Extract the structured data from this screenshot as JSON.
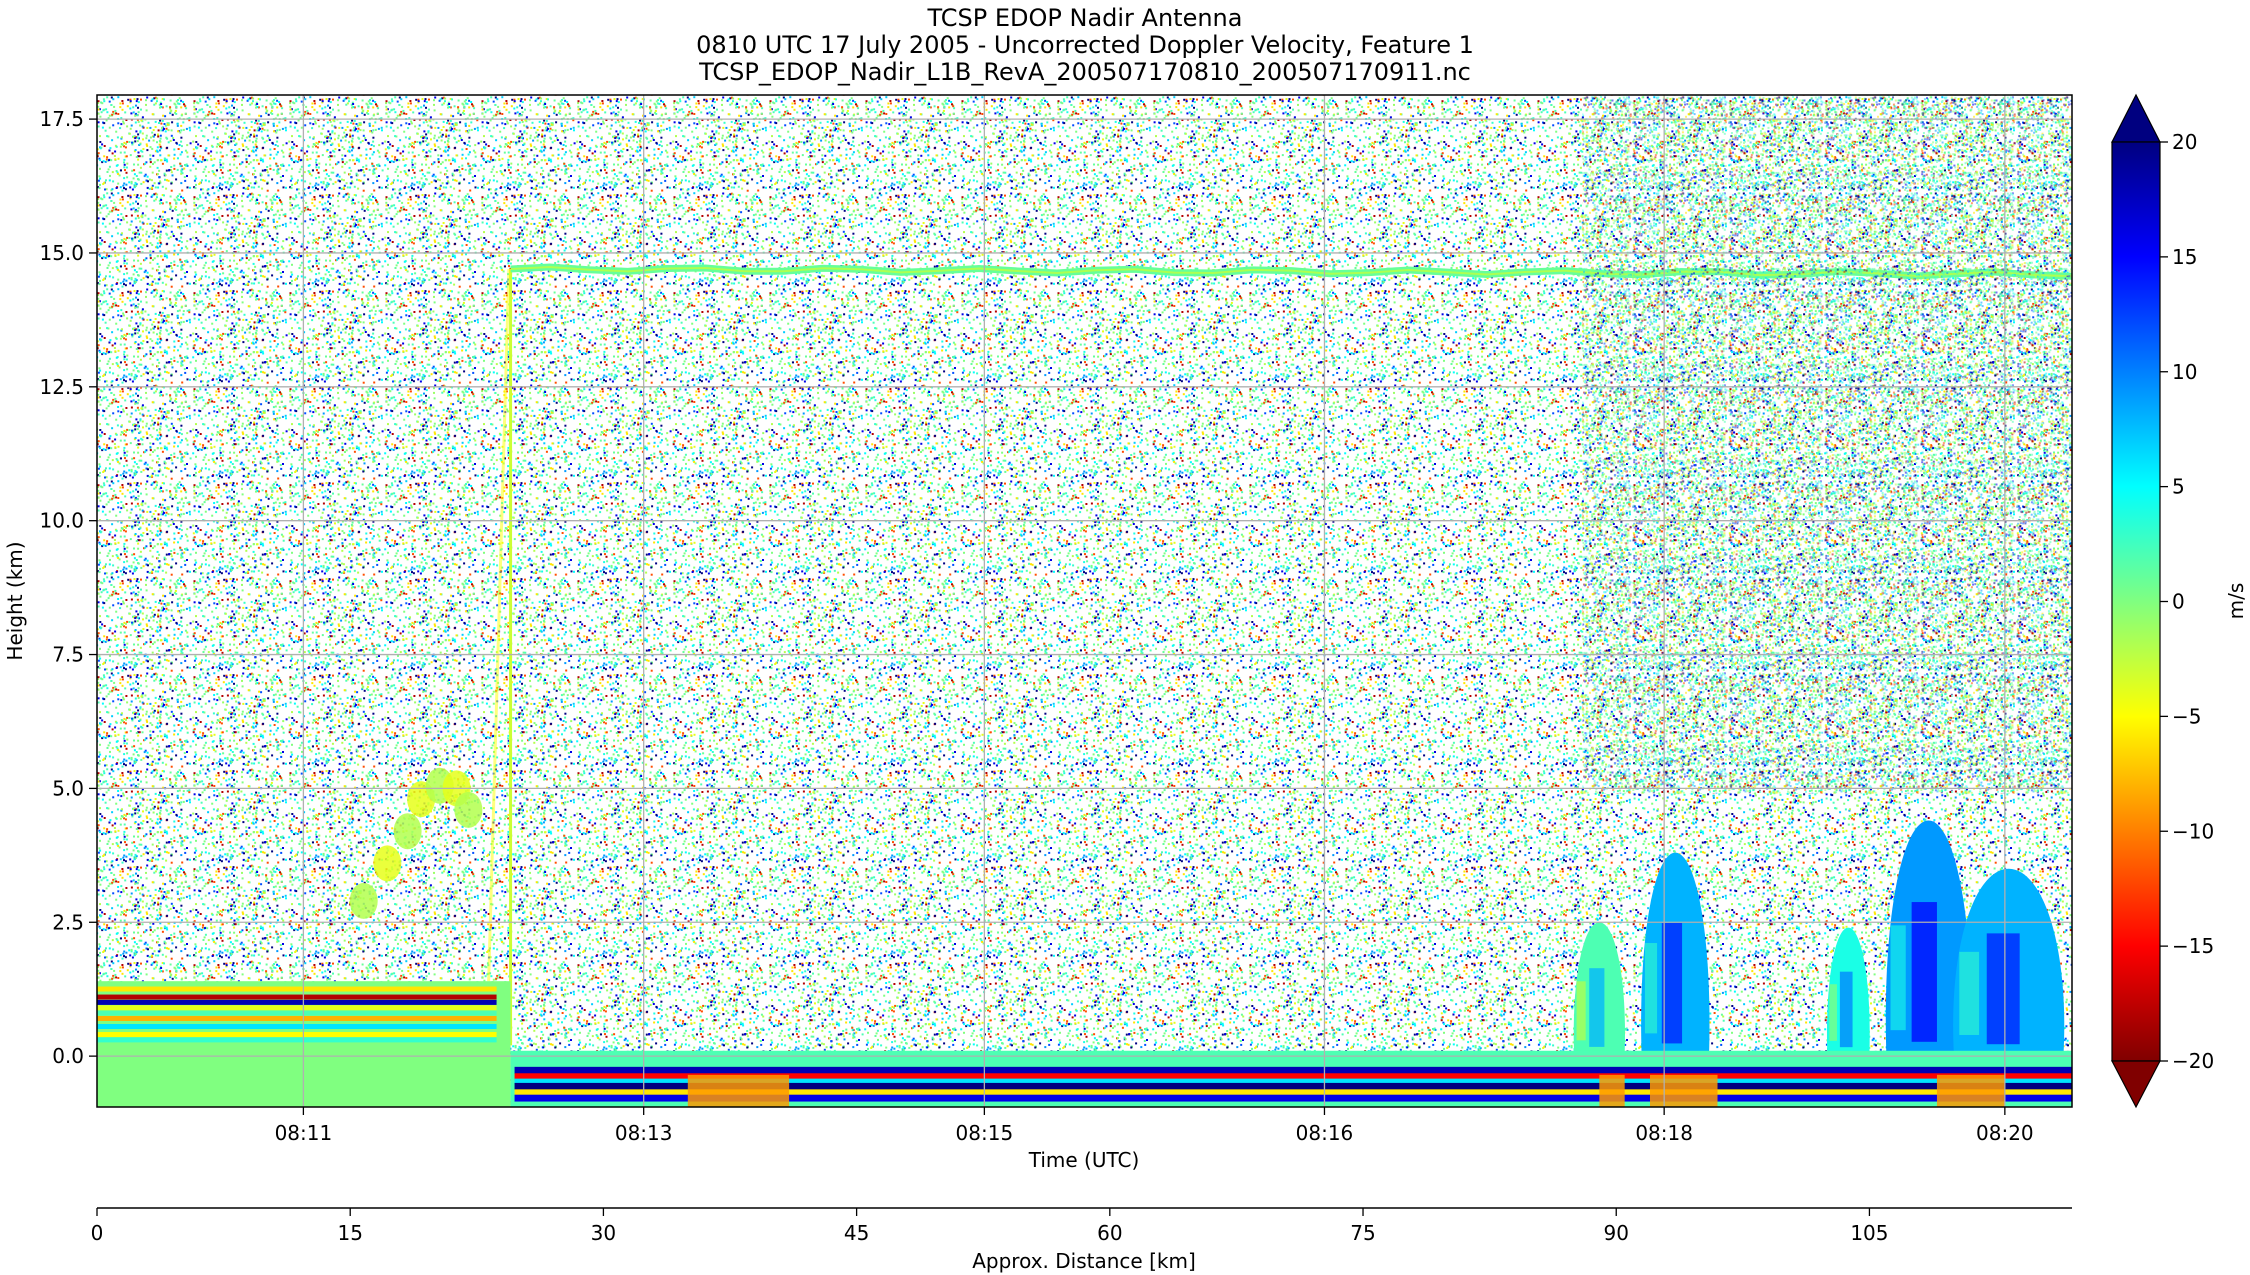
{
  "chart_data": {
    "type": "heatmap",
    "title_lines": [
      "TCSP EDOP Nadir Antenna",
      "0810 UTC 17 July 2005 - Uncorrected Doppler Velocity, Feature 1",
      "TCSP_EDOP_Nadir_L1B_RevA_200507170810_200507170911.nc"
    ],
    "xlabel": "Time (UTC)",
    "ylabel": "Height (km)",
    "x2label": "Approx. Distance [km]",
    "colorbar_label": "m/s",
    "ylim": [
      -0.95,
      17.95
    ],
    "y_ticks": [
      0.0,
      2.5,
      5.0,
      7.5,
      10.0,
      12.5,
      15.0,
      17.5
    ],
    "y_tick_labels": [
      "0.0",
      "2.5",
      "5.0",
      "7.5",
      "10.0",
      "12.5",
      "15.0",
      "17.5"
    ],
    "x_tick_labels": [
      "08:11",
      "08:13",
      "08:15",
      "08:16",
      "08:18",
      "08:20"
    ],
    "distance_ticks": [
      0,
      15,
      30,
      45,
      60,
      75,
      90,
      105
    ],
    "distance_tick_labels": [
      "0",
      "15",
      "30",
      "45",
      "60",
      "75",
      "90",
      "105"
    ],
    "distance_range": [
      0,
      117
    ],
    "colorbar_range": [
      -20,
      20
    ],
    "colorbar_ticks": [
      -20,
      -15,
      -10,
      -5,
      0,
      5,
      10,
      15,
      20
    ],
    "colorbar_tick_labels": [
      "−20",
      "−15",
      "−10",
      "−5",
      "0",
      "5",
      "10",
      "15",
      "20"
    ],
    "colormap": "jet",
    "colormap_stops": [
      "#800000",
      "#ff0000",
      "#ff8000",
      "#ffff00",
      "#80ff80",
      "#00ffff",
      "#0080ff",
      "#0000ff",
      "#000080"
    ],
    "grid": true,
    "features": [
      {
        "kind": "cloud_top_band",
        "x_from": 24.5,
        "x_to": 117,
        "y_from": 14.7,
        "y_to": 14.6,
        "value": 1
      },
      {
        "kind": "convective_cell",
        "x_from": 87.5,
        "x_to": 90.5,
        "y_top": 2.5,
        "value": 2
      },
      {
        "kind": "convective_cell",
        "x_from": 91.5,
        "x_to": 95.5,
        "y_top": 3.8,
        "value": 8
      },
      {
        "kind": "convective_cell",
        "x_from": 102.5,
        "x_to": 105,
        "y_top": 2.4,
        "value": 4
      },
      {
        "kind": "convective_cell",
        "x_from": 106,
        "x_to": 111,
        "y_top": 4.4,
        "value": 9
      },
      {
        "kind": "convective_cell",
        "x_from": 110,
        "x_to": 116.5,
        "y_top": 3.5,
        "value": 8
      },
      {
        "kind": "mid_level_echo",
        "x_from": 15.5,
        "x_to": 22,
        "y_from": 2.8,
        "y_to": 5.1,
        "value": -2
      },
      {
        "kind": "surface_layer_left",
        "x_from": 0,
        "x_to": 24.5,
        "y_from": -0.95,
        "y_to": 1.4,
        "value": 0
      },
      {
        "kind": "surface_layer_right",
        "x_from": 24.5,
        "x_to": 117,
        "y_from": -0.95,
        "y_to": 0.1,
        "value": 2
      }
    ]
  }
}
